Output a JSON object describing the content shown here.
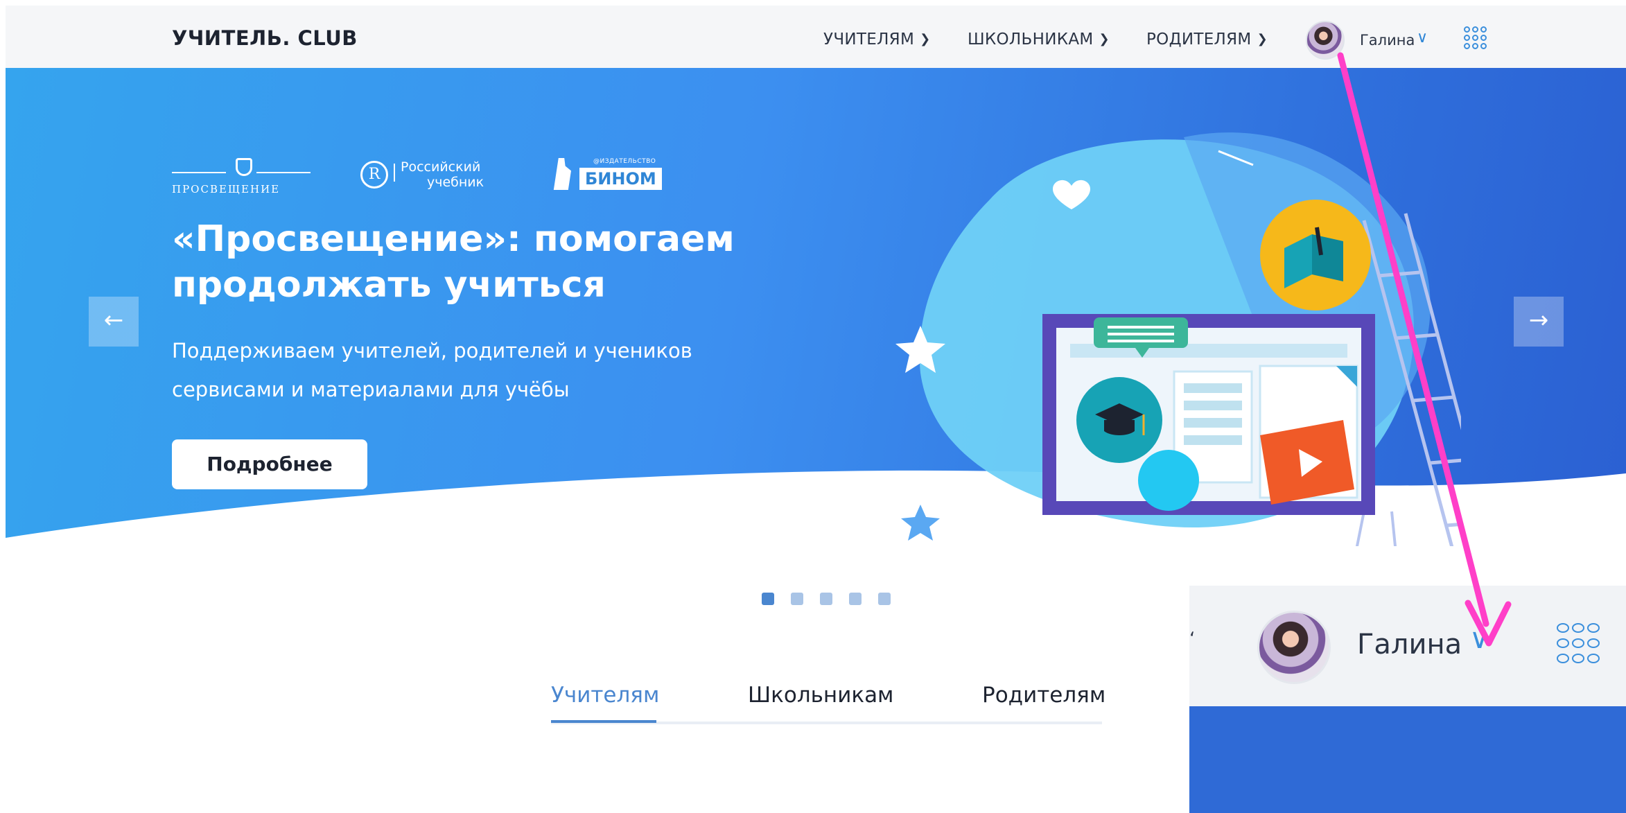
{
  "header": {
    "brand": "УЧИТЕЛЬ. CLUB",
    "nav": [
      {
        "label": "УЧИТЕЛЯМ"
      },
      {
        "label": "ШКОЛЬНИКАМ"
      },
      {
        "label": "РОДИТЕЛЯМ"
      }
    ],
    "user": {
      "name": "Галина"
    },
    "icons": {
      "chevron": "chevron-down-icon",
      "apps": "apps-grid-icon"
    }
  },
  "hero": {
    "logos": {
      "prosveshchenie": "ПРОСВЕЩЕНИЕ",
      "rossiyskiy_line1": "Российский",
      "rossiyskiy_line2": "учебник",
      "binom_small": "@ИЗДАТЕЛЬСТВО",
      "binom": "БИНОМ"
    },
    "title": "«Просвещение»: помогаем продолжать учиться",
    "subtitle": "Поддерживаем учителей, родителей и учеников сервисами и материалами для учёбы",
    "cta": "Подробнее",
    "prev_arrow": "←",
    "next_arrow": "→"
  },
  "carousel": {
    "slides": 5,
    "active": 1
  },
  "tabs": [
    {
      "label": "Учителям",
      "active": true
    },
    {
      "label": "Школьникам",
      "active": false
    },
    {
      "label": "Родителям",
      "active": false
    }
  ],
  "zoom": {
    "user_name": "Галина",
    "fragment": "ʻ"
  },
  "colors": {
    "accent": "#4a86cf",
    "hero_start": "#35a4ee",
    "hero_end": "#2b60d2",
    "annotation": "#ff3fc8"
  }
}
